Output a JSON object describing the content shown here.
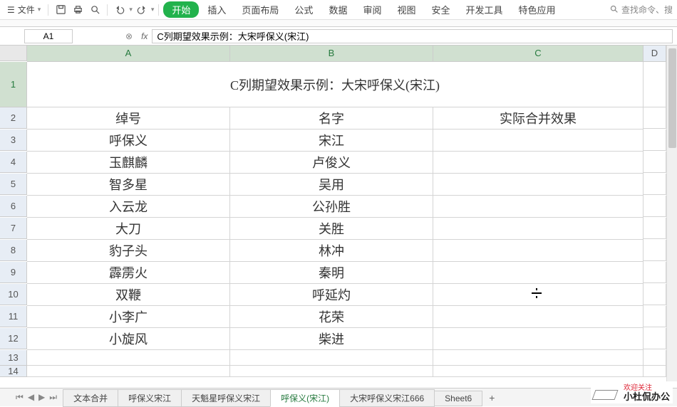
{
  "menu": {
    "file": "文件",
    "tabs": [
      "开始",
      "插入",
      "页面布局",
      "公式",
      "数据",
      "审阅",
      "视图",
      "安全",
      "开发工具",
      "特色应用"
    ],
    "active_tab": 0,
    "search": "查找命令、搜"
  },
  "namebox": "A1",
  "fx": "fx",
  "formula": "C列期望效果示例：大宋呼保义(宋江)",
  "columns": [
    "A",
    "B",
    "C",
    "D"
  ],
  "grid": {
    "title": "C列期望效果示例：大宋呼保义(宋江)",
    "headers": [
      "绰号",
      "名字",
      "实际合并效果"
    ],
    "rows": [
      {
        "a": "呼保义",
        "b": "宋江",
        "c": ""
      },
      {
        "a": "玉麒麟",
        "b": "卢俊义",
        "c": ""
      },
      {
        "a": "智多星",
        "b": "吴用",
        "c": ""
      },
      {
        "a": "入云龙",
        "b": "公孙胜",
        "c": ""
      },
      {
        "a": "大刀",
        "b": "关胜",
        "c": ""
      },
      {
        "a": "豹子头",
        "b": "林冲",
        "c": ""
      },
      {
        "a": "霹雳火",
        "b": "秦明",
        "c": ""
      },
      {
        "a": "双鞭",
        "b": "呼延灼",
        "c": ""
      },
      {
        "a": "小李广",
        "b": "花荣",
        "c": ""
      },
      {
        "a": "小旋风",
        "b": "柴进",
        "c": ""
      }
    ]
  },
  "sheets": {
    "tabs": [
      "文本合并",
      "呼保义宋江",
      "天魁星呼保义宋江",
      "呼保义(宋江)",
      "大宋呼保义宋江666",
      "Sheet6"
    ],
    "active": 3
  },
  "watermark": {
    "line1": "欢迎关注",
    "line2": "小杜侃办公"
  }
}
